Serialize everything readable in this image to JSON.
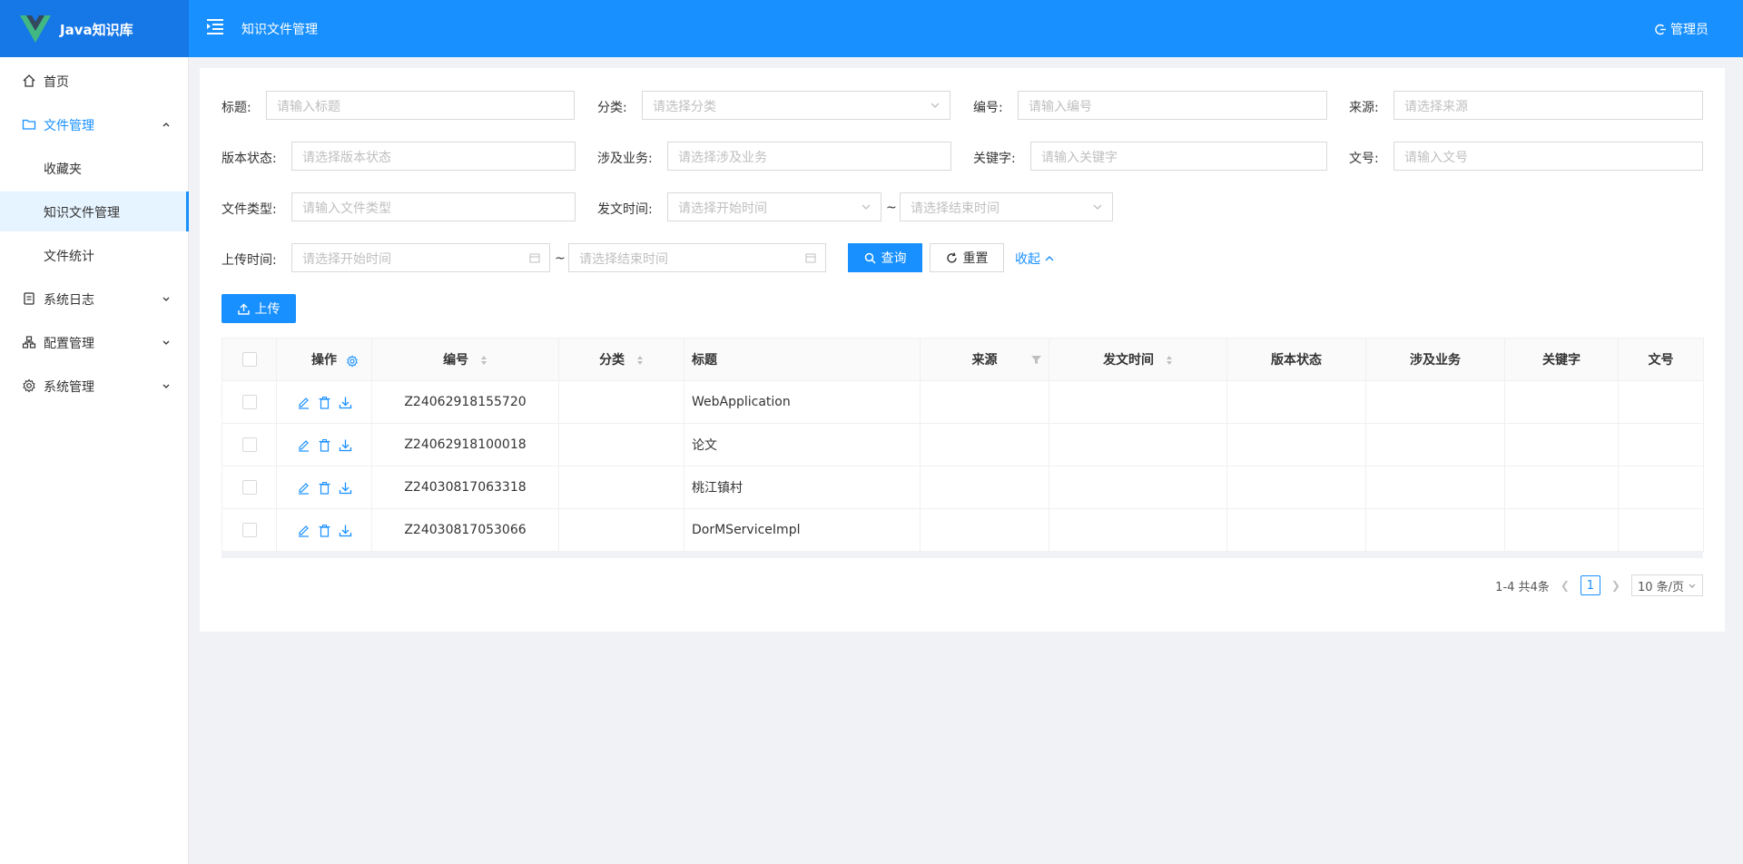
{
  "header": {
    "app_name": "Java知识库",
    "page_title": "知识文件管理",
    "user": "管理员"
  },
  "sidebar": {
    "items": [
      {
        "label": "首页",
        "icon": "home-icon"
      },
      {
        "label": "文件管理",
        "icon": "folder-icon",
        "expanded": true
      },
      {
        "label": "收藏夹"
      },
      {
        "label": "知识文件管理",
        "selected": true
      },
      {
        "label": "文件统计"
      },
      {
        "label": "系统日志",
        "icon": "log-icon"
      },
      {
        "label": "配置管理",
        "icon": "config-icon"
      },
      {
        "label": "系统管理",
        "icon": "gear-icon"
      }
    ]
  },
  "filters": {
    "title_label": "标题:",
    "title_placeholder": "请输入标题",
    "category_label": "分类:",
    "category_placeholder": "请选择分类",
    "number_label": "编号:",
    "number_placeholder": "请输入编号",
    "source_label": "来源:",
    "source_placeholder": "请选择来源",
    "version_label": "版本状态:",
    "version_placeholder": "请选择版本状态",
    "business_label": "涉及业务:",
    "business_placeholder": "请选择涉及业务",
    "keyword_label": "关键字:",
    "keyword_placeholder": "请输入关键字",
    "docno_label": "文号:",
    "docno_placeholder": "请输入文号",
    "filetype_label": "文件类型:",
    "filetype_placeholder": "请输入文件类型",
    "pubtime_label": "发文时间:",
    "pubtime_start": "请选择开始时间",
    "pubtime_end": "请选择结束时间",
    "uploadtime_label": "上传时间:",
    "uploadtime_start": "请选择开始时间",
    "uploadtime_end": "请选择结束时间",
    "tilde": "~",
    "query_button": "查询",
    "reset_button": "重置",
    "collapse_link": "收起"
  },
  "upload_button": "上传",
  "table": {
    "columns": [
      "操作",
      "编号",
      "分类",
      "标题",
      "来源",
      "发文时间",
      "版本状态",
      "涉及业务",
      "关键字",
      "文号"
    ],
    "rows": [
      {
        "number": "Z24062918155720",
        "category": "",
        "title": "WebApplication",
        "source": "",
        "pubtime": "",
        "version": "",
        "business": "",
        "keyword": "",
        "docno": ""
      },
      {
        "number": "Z24062918100018",
        "category": "",
        "title": "论文",
        "source": "",
        "pubtime": "",
        "version": "",
        "business": "",
        "keyword": "",
        "docno": ""
      },
      {
        "number": "Z24030817063318",
        "category": "",
        "title": "桃江镇村",
        "source": "",
        "pubtime": "",
        "version": "",
        "business": "",
        "keyword": "",
        "docno": ""
      },
      {
        "number": "Z24030817053066",
        "category": "",
        "title": "DorMServiceImpl",
        "source": "",
        "pubtime": "",
        "version": "",
        "business": "",
        "keyword": "",
        "docno": ""
      }
    ]
  },
  "pagination": {
    "summary": "1-4 共4条",
    "current_page": "1",
    "page_size": "10 条/页"
  },
  "colors": {
    "primary": "#1890ff",
    "header_bg": "#1890ff",
    "highlight_title": "#f5222d"
  }
}
